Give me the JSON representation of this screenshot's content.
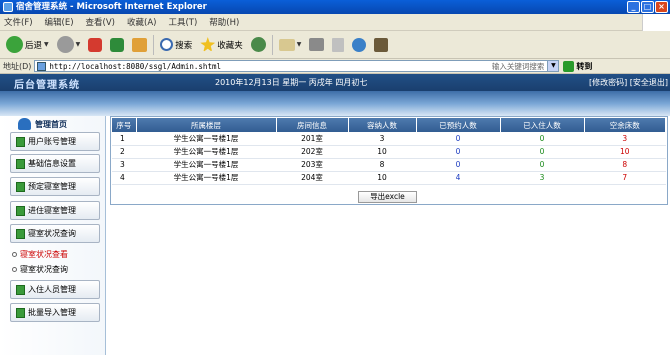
{
  "window": {
    "title": "宿舍管理系统 - Microsoft Internet Explorer"
  },
  "menu": [
    "文件(F)",
    "编辑(E)",
    "查看(V)",
    "收藏(A)",
    "工具(T)",
    "帮助(H)"
  ],
  "toolbar": {
    "back": "后退",
    "search": "搜索",
    "favorites": "收藏夹"
  },
  "address": {
    "label": "地址(D)",
    "url": "http://localhost:8080/ssgl/Admin.shtml",
    "search_hint": "输入关键词搜索",
    "go": "转到"
  },
  "header": {
    "brand": "后台管理系统",
    "date": "2010年12月13日 星期一 丙戌年 四月初七",
    "links": "[修改密码] [安全退出]"
  },
  "sidebar": {
    "home": "管理首页",
    "buttons": [
      "用户账号管理",
      "基础信息设置",
      "预定寝室管理",
      "进住寝室管理",
      "寝室状况查询"
    ],
    "subitems": [
      {
        "label": "寝室状况查看",
        "active": true
      },
      {
        "label": "寝室状况查询",
        "active": false
      }
    ],
    "buttons2": [
      "入住人员管理",
      "批量导入管理"
    ]
  },
  "table": {
    "headers": [
      "序号",
      "所属楼层",
      "房间信息",
      "容纳人数",
      "已预约人数",
      "已入住人数",
      "空余床数"
    ],
    "rows": [
      [
        "1",
        "学生公寓一号楼1层",
        "201室",
        "3",
        "0",
        "0",
        "3"
      ],
      [
        "2",
        "学生公寓一号楼1层",
        "202室",
        "10",
        "0",
        "0",
        "10"
      ],
      [
        "3",
        "学生公寓一号楼1层",
        "203室",
        "8",
        "0",
        "0",
        "8"
      ],
      [
        "4",
        "学生公寓一号楼1层",
        "204室",
        "10",
        "4",
        "3",
        "7"
      ]
    ]
  },
  "export": {
    "label": "导出excle"
  }
}
